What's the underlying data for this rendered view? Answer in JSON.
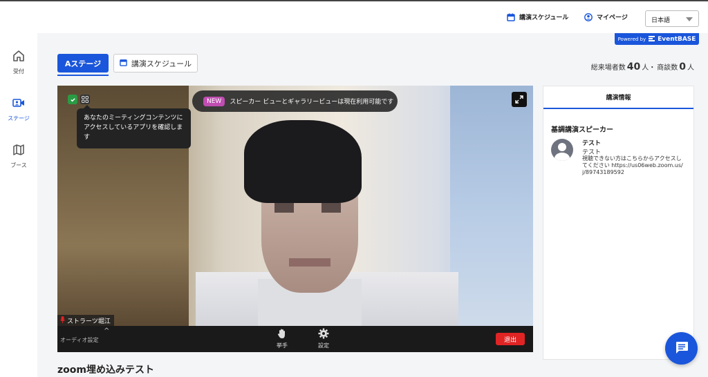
{
  "header": {
    "schedule_link": "講演スケジュール",
    "mypage_link": "マイページ",
    "language": "日本語",
    "powered_by_prefix": "Powered by",
    "powered_by_brand": "EventBASE"
  },
  "sidebar": {
    "items": [
      {
        "label": "受付",
        "icon": "home-icon"
      },
      {
        "label": "ステージ",
        "icon": "video-camera-icon",
        "active": true
      },
      {
        "label": "ブース",
        "icon": "map-icon"
      }
    ]
  },
  "tabs": {
    "stage_a": "Aステージ",
    "schedule": "講演スケジュール"
  },
  "counts": {
    "visitors_label": "総来場者数",
    "visitors_value": "40",
    "visitors_unit": "人・",
    "meetings_label": "商談数",
    "meetings_value": "0",
    "meetings_unit": "人"
  },
  "video": {
    "tooltip": "あなたのミーティングコンテンツにアクセスしているアプリを確認します",
    "banner_badge": "NEW",
    "banner_text": "スピーカー ビューとギャラリービューは現在利用可能です",
    "participant_name": "ストラーツ堀江",
    "audio_settings": "オーディオ設定",
    "raise_hand": "挙手",
    "settings": "設定",
    "leave": "退出"
  },
  "info_panel": {
    "title": "講演情報",
    "subtitle": "基調講演スピーカー",
    "speaker_name": "テスト",
    "speaker_role": "テスト",
    "speaker_desc": "視聴できない方はこちらからアクセスしてください https://us06web.zoom.us/j/89743189592"
  },
  "page_title": "zoom埋め込みテスト",
  "colors": {
    "accent": "#1a56db",
    "leave": "#e02424",
    "secure": "#2b9a44"
  }
}
